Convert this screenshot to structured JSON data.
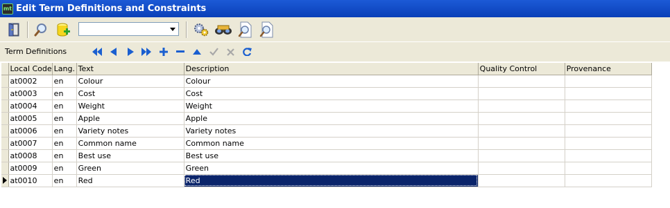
{
  "window": {
    "title": "Edit Term Definitions and Constraints",
    "app_icon_text": "mt"
  },
  "toolbar": {
    "icons": [
      "exit-door-icon",
      "search-icon",
      "add-database-icon",
      "settings-gears-icon",
      "binoculars-icon",
      "zoom-page-icon",
      "zoom-page-alt-icon"
    ],
    "combo_value": ""
  },
  "navigator": {
    "label": "Term Definitions",
    "buttons": [
      "first",
      "prior",
      "next",
      "last",
      "insert",
      "delete",
      "edit",
      "post",
      "cancel",
      "refresh"
    ]
  },
  "grid": {
    "columns": [
      "Local Code",
      "Lang.",
      "Text",
      "Description",
      "Quality Control",
      "Provenance"
    ],
    "rows": [
      {
        "code": "at0002",
        "lang": "en",
        "text": "Colour",
        "description": "Colour",
        "qc": "",
        "prov": ""
      },
      {
        "code": "at0003",
        "lang": "en",
        "text": "Cost",
        "description": "Cost",
        "qc": "",
        "prov": ""
      },
      {
        "code": "at0004",
        "lang": "en",
        "text": "Weight",
        "description": "Weight",
        "qc": "",
        "prov": ""
      },
      {
        "code": "at0005",
        "lang": "en",
        "text": "Apple",
        "description": "Apple",
        "qc": "",
        "prov": ""
      },
      {
        "code": "at0006",
        "lang": "en",
        "text": "Variety notes",
        "description": "Variety notes",
        "qc": "",
        "prov": ""
      },
      {
        "code": "at0007",
        "lang": "en",
        "text": "Common name",
        "description": "Common name",
        "qc": "",
        "prov": ""
      },
      {
        "code": "at0008",
        "lang": "en",
        "text": "Best use",
        "description": "Best use",
        "qc": "",
        "prov": ""
      },
      {
        "code": "at0009",
        "lang": "en",
        "text": "Green",
        "description": "Green",
        "qc": "",
        "prov": ""
      },
      {
        "code": "at0010",
        "lang": "en",
        "text": "Red",
        "description": "Red",
        "qc": "",
        "prov": ""
      }
    ],
    "current_row": 8,
    "selected_column": "Description"
  },
  "colors": {
    "title_bar": "#0a3fb8",
    "selection": "#0a246a",
    "nav_icon": "#1a5fd0",
    "face": "#ece9d8"
  }
}
